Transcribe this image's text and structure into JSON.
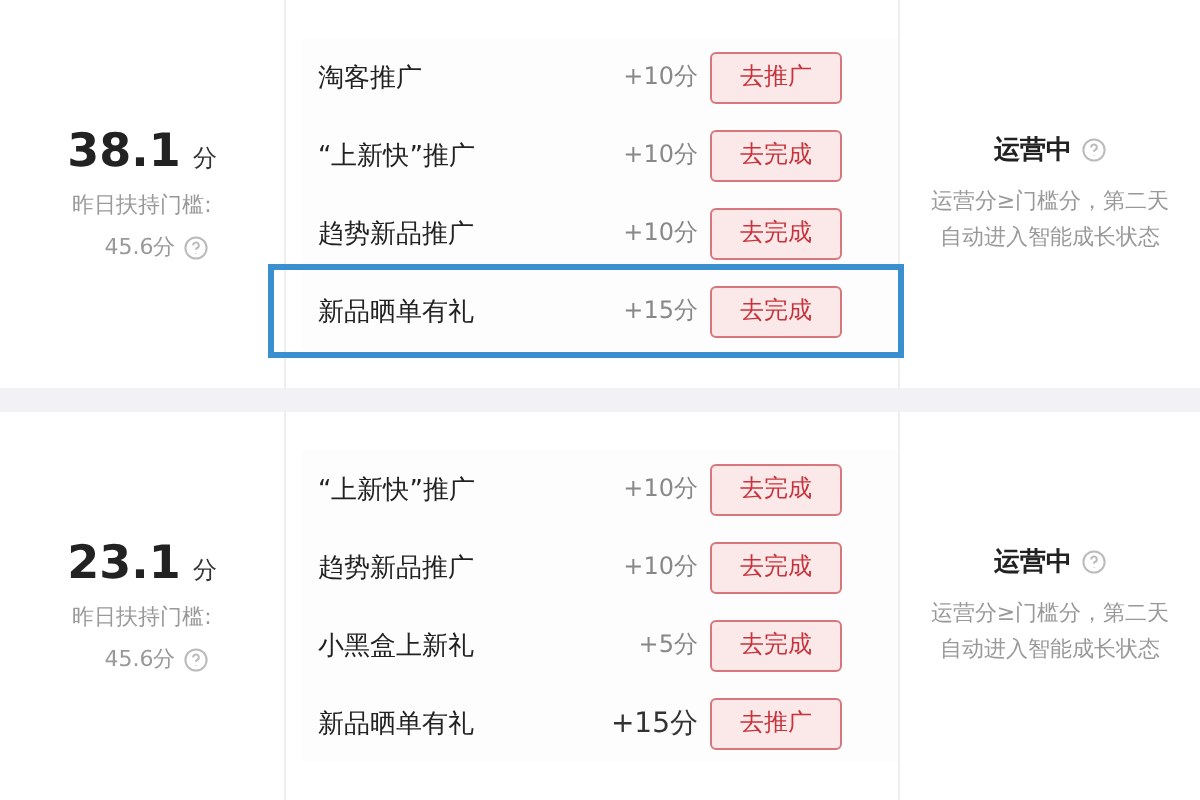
{
  "sections": [
    {
      "score": "38.1",
      "score_unit": "分",
      "threshold_label": "昨日扶持门槛:",
      "threshold_value": "45.6分",
      "status": "运营中",
      "status_note": "运营分≥门槛分，第二天自动进入智能成长状态",
      "tasks": [
        {
          "name": "淘客推广",
          "points": "+10分",
          "action": "去推广",
          "highlighted": false,
          "emphasized": false
        },
        {
          "name": "“上新快”推广",
          "points": "+10分",
          "action": "去完成",
          "highlighted": false,
          "emphasized": false
        },
        {
          "name": "趋势新品推广",
          "points": "+10分",
          "action": "去完成",
          "highlighted": false,
          "emphasized": false
        },
        {
          "name": "新品晒单有礼",
          "points": "+15分",
          "action": "去完成",
          "highlighted": true,
          "emphasized": false
        }
      ]
    },
    {
      "score": "23.1",
      "score_unit": "分",
      "threshold_label": "昨日扶持门槛:",
      "threshold_value": "45.6分",
      "status": "运营中",
      "status_note": "运营分≥门槛分，第二天自动进入智能成长状态",
      "tasks": [
        {
          "name": "“上新快”推广",
          "points": "+10分",
          "action": "去完成",
          "highlighted": false,
          "emphasized": false
        },
        {
          "name": "趋势新品推广",
          "points": "+10分",
          "action": "去完成",
          "highlighted": false,
          "emphasized": false
        },
        {
          "name": "小黑盒上新礼",
          "points": "+5分",
          "action": "去完成",
          "highlighted": false,
          "emphasized": false
        },
        {
          "name": "新品晒单有礼",
          "points": "+15分",
          "action": "去推广",
          "highlighted": false,
          "emphasized": true
        }
      ]
    }
  ]
}
